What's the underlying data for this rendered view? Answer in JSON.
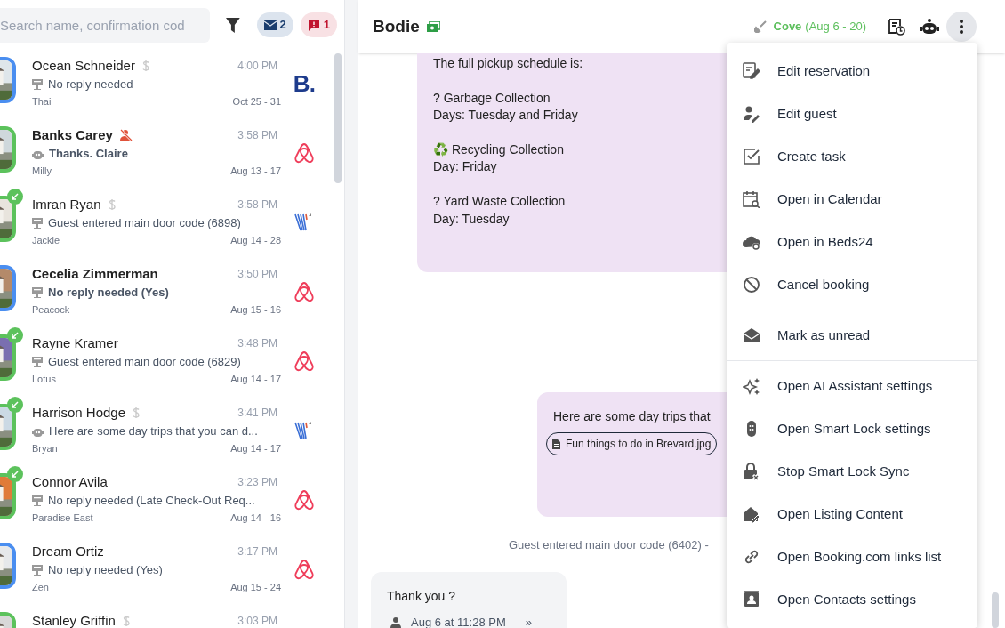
{
  "search": {
    "placeholder": "Search name, confirmation cod"
  },
  "counters": [
    {
      "kind": "mail",
      "count": "2"
    },
    {
      "kind": "alert",
      "count": "1"
    }
  ],
  "conversations": [
    {
      "name": "Ocean Schneider",
      "unread": false,
      "paid": true,
      "muted": false,
      "time": "4:00 PM",
      "preview": {
        "kind": "note",
        "text": "No reply needed"
      },
      "listing": "Thai",
      "dates": "Oct 25 - 31",
      "channel": {
        "kind": "booking",
        "text": "B."
      },
      "color": "#4a8ef0",
      "badge": false,
      "selected": false
    },
    {
      "name": "Banks Carey",
      "unread": true,
      "paid": false,
      "muted": true,
      "time": "3:58 PM",
      "preview": {
        "kind": "bot",
        "text": "Thanks. Claire"
      },
      "listing": "Milly",
      "dates": "Aug 13 - 17",
      "channel": {
        "kind": "airbnb"
      },
      "color": "#5cc25c",
      "badge": false,
      "selected": false
    },
    {
      "name": "Imran Ryan",
      "unread": false,
      "paid": true,
      "muted": false,
      "time": "3:58 PM",
      "preview": {
        "kind": "note",
        "text": "Guest entered main door code (6898)"
      },
      "listing": "Jackie",
      "dates": "Aug 14 - 28",
      "channel": {
        "kind": "vrbo"
      },
      "color": "#5cc25c",
      "badge": true,
      "selected": false
    },
    {
      "name": "Cecelia Zimmerman",
      "unread": true,
      "paid": false,
      "muted": false,
      "time": "3:50 PM",
      "preview": {
        "kind": "note",
        "text": "No reply needed (Yes)"
      },
      "listing": "Peacock",
      "dates": "Aug 15 - 16",
      "channel": {
        "kind": "airbnb"
      },
      "color": "#4a8ef0",
      "badge": false,
      "selected": false
    },
    {
      "name": "Rayne Kramer",
      "unread": false,
      "paid": false,
      "muted": false,
      "time": "3:48 PM",
      "preview": {
        "kind": "note",
        "text": "Guest entered main door code (6829)"
      },
      "listing": "Lotus",
      "dates": "Aug 14 - 17",
      "channel": {
        "kind": "airbnb"
      },
      "color": "#5cc25c",
      "badge": true,
      "selected": false
    },
    {
      "name": "Harrison Hodge",
      "unread": false,
      "paid": true,
      "muted": false,
      "time": "3:41 PM",
      "preview": {
        "kind": "bot",
        "text": "Here are some day trips that you can d..."
      },
      "listing": "Bryan",
      "dates": "Aug 14 - 17",
      "channel": {
        "kind": "vrbo"
      },
      "color": "#5cc25c",
      "badge": true,
      "selected": false
    },
    {
      "name": "Connor Avila",
      "unread": false,
      "paid": false,
      "muted": false,
      "time": "3:23 PM",
      "preview": {
        "kind": "note",
        "text": "No reply needed (Late Check-Out Req..."
      },
      "listing": "Paradise East",
      "dates": "Aug 14 - 16",
      "channel": {
        "kind": "airbnb"
      },
      "color": "#5cc25c",
      "badge": true,
      "selected": false
    },
    {
      "name": "Dream Ortiz",
      "unread": false,
      "paid": false,
      "muted": false,
      "time": "3:17 PM",
      "preview": {
        "kind": "note",
        "text": "No reply needed (Yes)"
      },
      "listing": "Zen",
      "dates": "Aug 15 - 24",
      "channel": {
        "kind": "airbnb"
      },
      "color": "#4a8ef0",
      "badge": false,
      "selected": false
    },
    {
      "name": "Stanley Griffin",
      "unread": false,
      "paid": true,
      "muted": false,
      "time": "3:03 PM",
      "color": "#5cc25c",
      "badge": false,
      "selected": false
    }
  ],
  "header": {
    "title": "Bodie",
    "listing": "Cove",
    "dates": "(Aug 6 - 20)"
  },
  "messages": [
    {
      "kind": "outgoing",
      "paragraphs": [
        [
          "The full pickup schedule is:"
        ],
        [
          "? Garbage Collection",
          "Days: Tuesday and Friday"
        ],
        [
          "♻️ Recycling Collection",
          "Day: Friday"
        ],
        [
          "? Yard Waste Collection",
          "Day: Tuesday"
        ]
      ]
    },
    {
      "kind": "outgoing",
      "paragraphs": [
        [
          "Here are some day trips that"
        ]
      ],
      "attachment": "Fun things to do in Brevard.jpg"
    },
    {
      "kind": "system",
      "text": "Guest entered main door code (6402) -"
    },
    {
      "kind": "incoming",
      "paragraphs": [
        [
          "Thank you ?"
        ]
      ],
      "time": "Aug 6 at 11:28 PM",
      "more": "»"
    }
  ],
  "menu": [
    {
      "label": "Edit reservation",
      "divider_after": false
    },
    {
      "label": "Edit guest",
      "divider_after": false
    },
    {
      "label": "Create task",
      "divider_after": false
    },
    {
      "label": "Open in Calendar",
      "divider_after": false
    },
    {
      "label": "Open in Beds24",
      "divider_after": false
    },
    {
      "label": "Cancel booking",
      "divider_after": true
    },
    {
      "label": "Mark as unread",
      "divider_after": true
    },
    {
      "label": "Open AI Assistant settings",
      "divider_after": false
    },
    {
      "label": "Open Smart Lock settings",
      "divider_after": false
    },
    {
      "label": "Stop Smart Lock Sync",
      "divider_after": false
    },
    {
      "label": "Open Listing Content",
      "divider_after": false
    },
    {
      "label": "Open Booking.com links list",
      "divider_after": false
    },
    {
      "label": "Open Contacts settings",
      "divider_after": false
    }
  ]
}
